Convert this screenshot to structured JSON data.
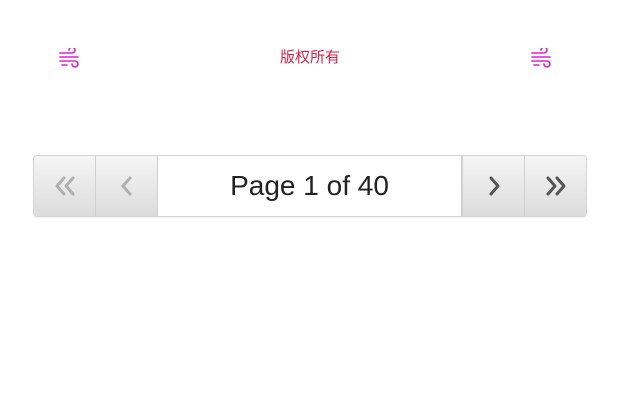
{
  "header": {
    "copyright_text": "版权所有",
    "copyright_color": "#d9224a",
    "left_icon": "wind-icon",
    "right_icon": "wind-icon",
    "icon_color": "#e020d0"
  },
  "pager": {
    "first_icon": "double-chevron-left-icon",
    "prev_icon": "chevron-left-icon",
    "next_icon": "chevron-right-icon",
    "last_icon": "double-chevron-right-icon",
    "page_label": "Page 1 of 40",
    "disabled_color": "#b0b0b0",
    "enabled_color": "#555555"
  }
}
